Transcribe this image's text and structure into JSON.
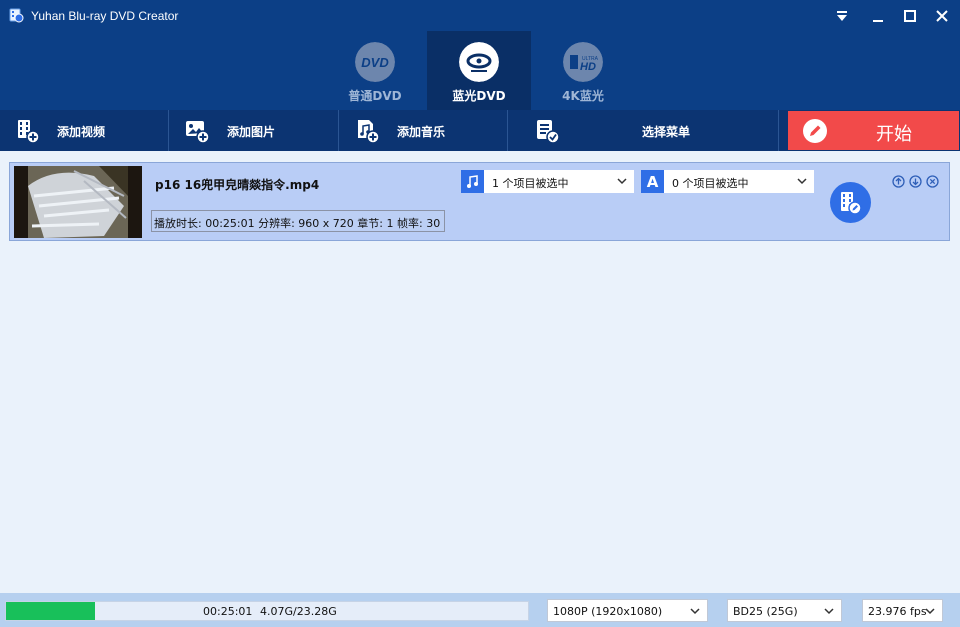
{
  "window": {
    "title": "Yuhan Blu-ray DVD Creator"
  },
  "mode_tabs": [
    {
      "label": "普通DVD",
      "icon": "dvd-icon"
    },
    {
      "label": "蓝光DVD",
      "icon": "bluray-disc-icon",
      "active": true
    },
    {
      "label": "4K蓝光",
      "icon": "ultra-hd-icon"
    }
  ],
  "toolbar": {
    "add_video": "添加视频",
    "add_image": "添加图片",
    "add_music": "添加音乐",
    "select_menu": "选择菜单",
    "start": "开始"
  },
  "file": {
    "name": "p16 16兜甲皃晴燚指令.mp4",
    "info": "播放时长: 00:25:01  分辨率: 960 x 720  章节: 1  帧率: 30",
    "audio_select": "1 个项目被选中",
    "subtitle_select": "0 个项目被选中",
    "subtitle_icon_letter": "A"
  },
  "status": {
    "progress": 0.17,
    "duration": "00:25:01",
    "size": "4.07G/23.28G",
    "resolution": "1080P (1920x1080)",
    "disc": "BD25 (25G)",
    "fps": "23.976 fps"
  },
  "colors": {
    "titlebar": "#0c3f86",
    "toolbar": "#0c3472",
    "accent_blue": "#2f6ee6",
    "start_red": "#f24a4a",
    "progress_green": "#18c05a"
  }
}
